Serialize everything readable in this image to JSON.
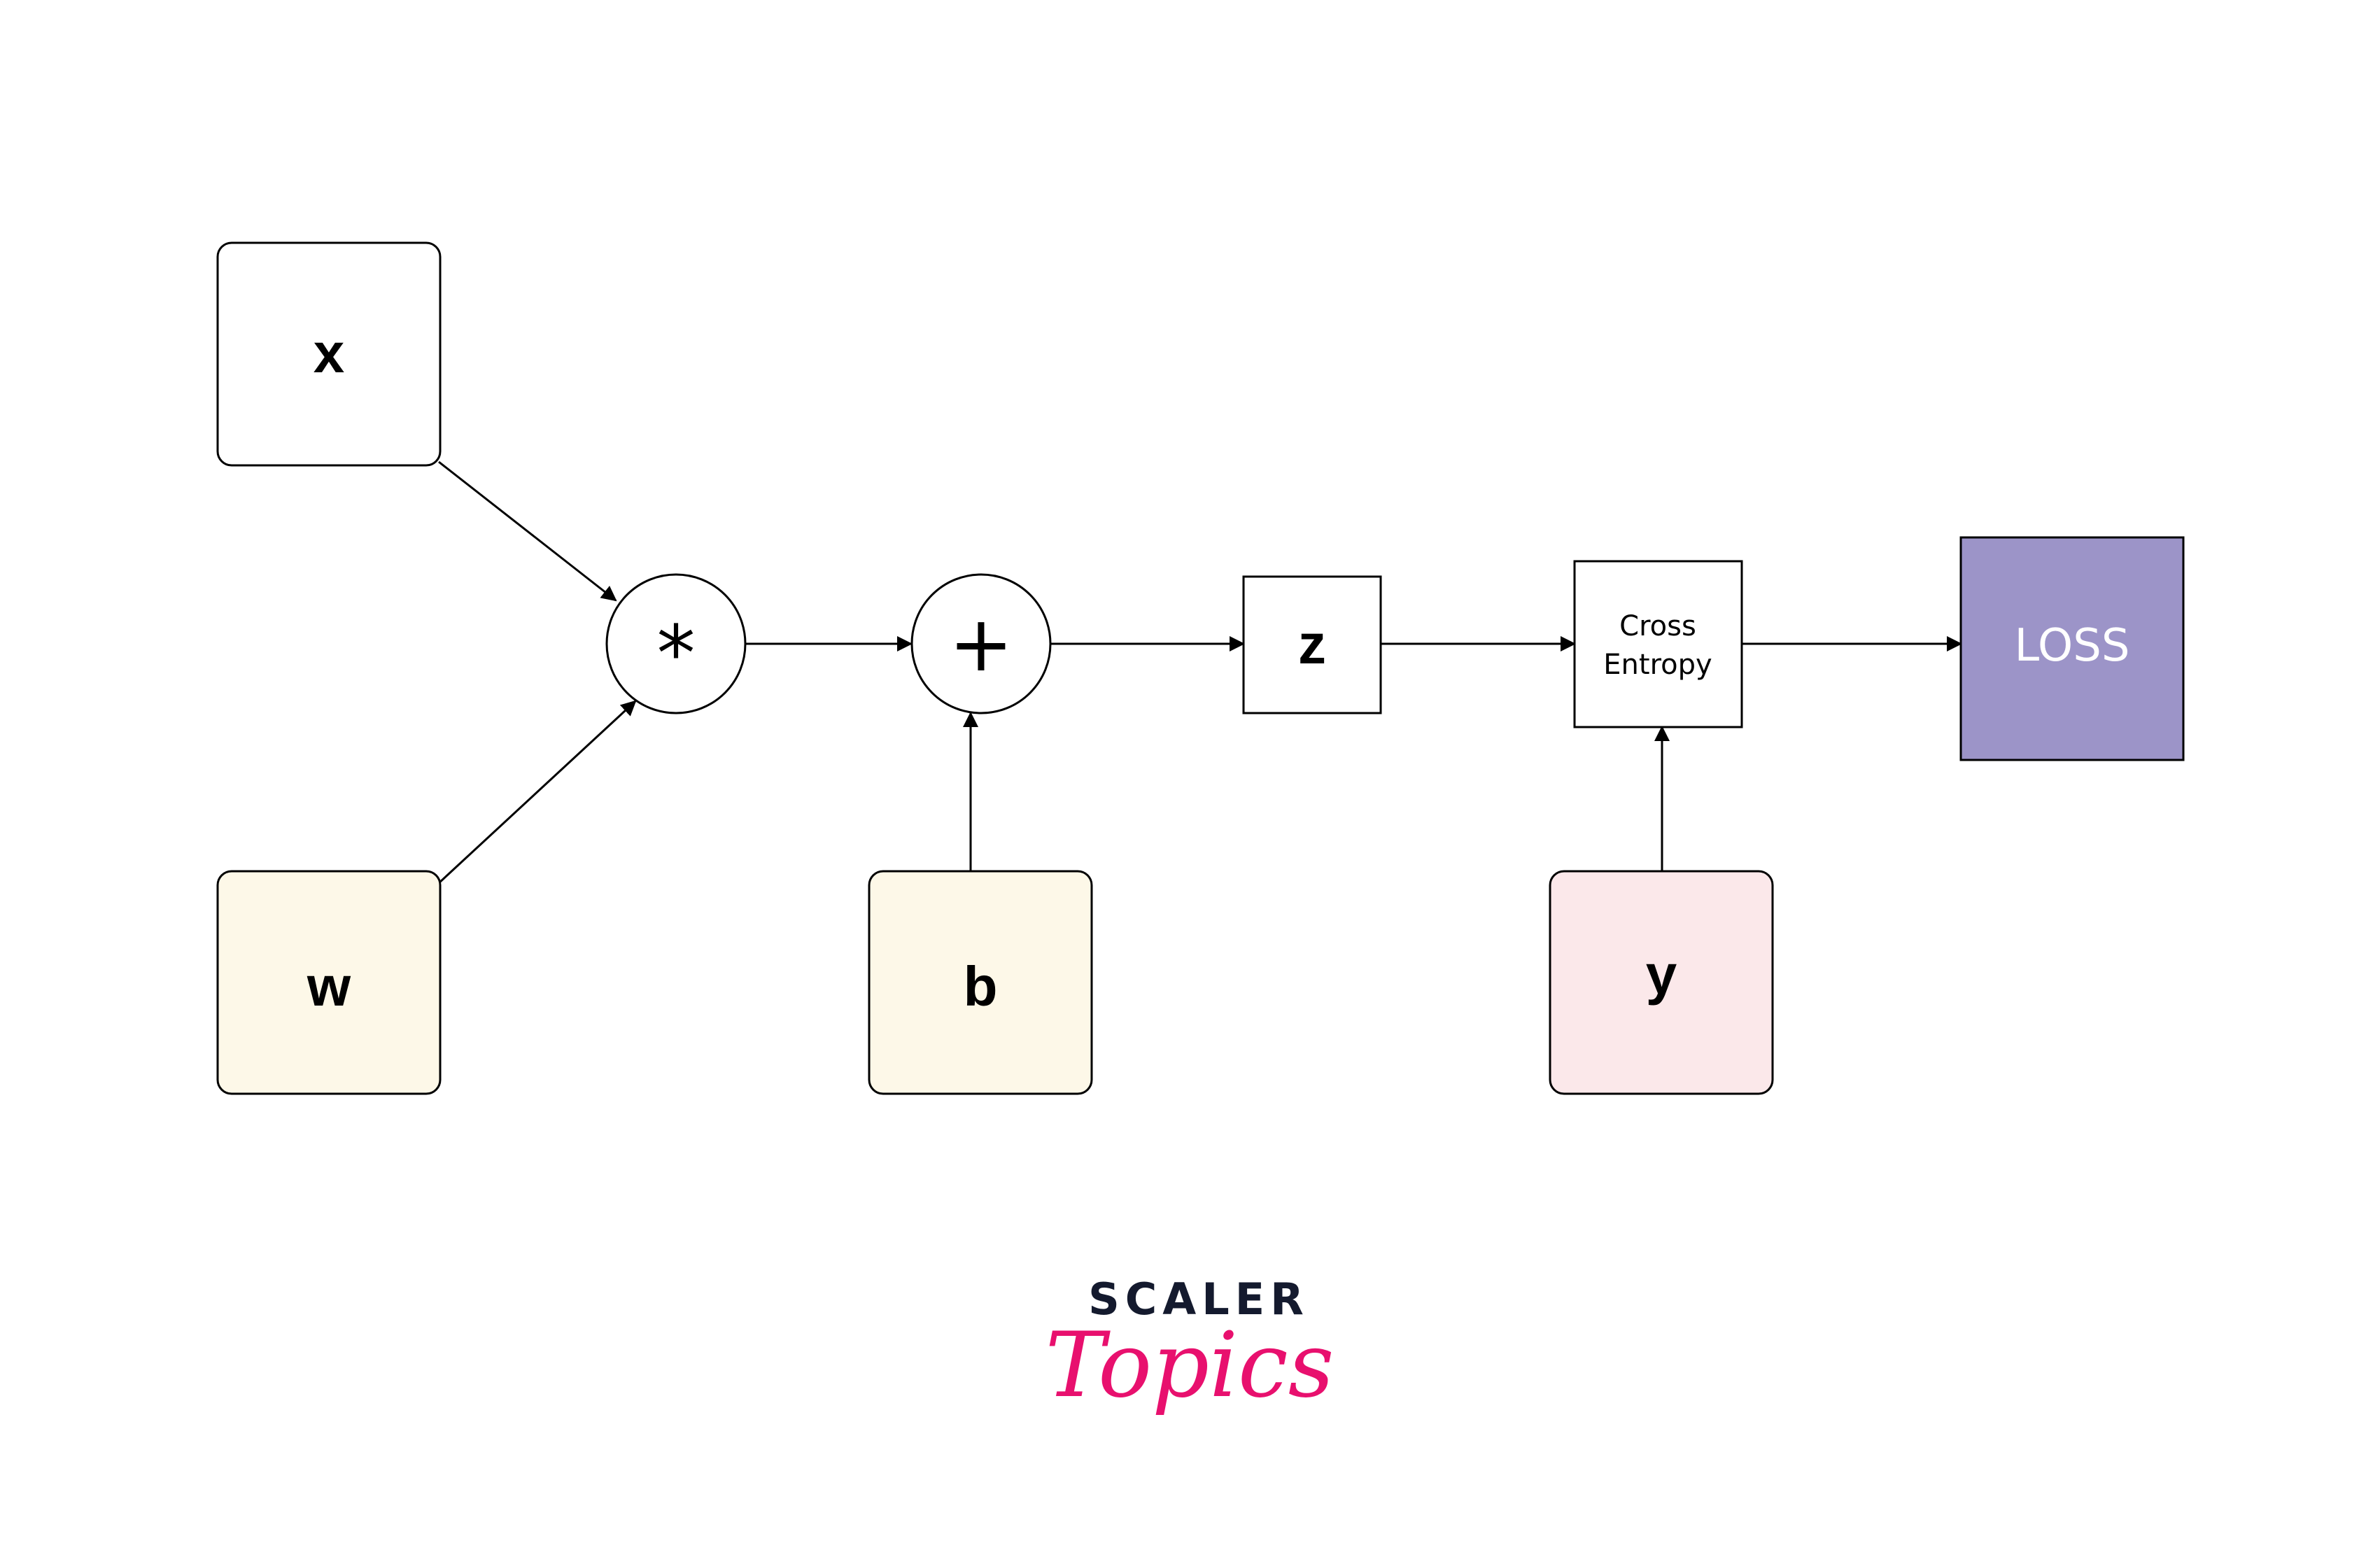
{
  "nodes": {
    "x": {
      "label": "x",
      "kind": "input",
      "fill": "#ffffff"
    },
    "w": {
      "label": "w",
      "kind": "parameter",
      "fill": "#fdf8e8"
    },
    "b": {
      "label": "b",
      "kind": "parameter",
      "fill": "#fdf8e8"
    },
    "y": {
      "label": "y",
      "kind": "target",
      "fill": "#fbe8ea"
    },
    "mul": {
      "label": "*",
      "kind": "operation"
    },
    "add": {
      "label": "+",
      "kind": "operation"
    },
    "z": {
      "label": "z",
      "kind": "intermediate",
      "fill": "#ffffff"
    },
    "cross_entropy": {
      "line1": "Cross",
      "line2": "Entropy",
      "kind": "function",
      "fill": "#ffffff"
    },
    "loss": {
      "label": "LOSS",
      "kind": "output",
      "fill": "#9c94c8"
    }
  },
  "edges": [
    {
      "from": "x",
      "to": "mul"
    },
    {
      "from": "w",
      "to": "mul"
    },
    {
      "from": "mul",
      "to": "add"
    },
    {
      "from": "b",
      "to": "add"
    },
    {
      "from": "add",
      "to": "z"
    },
    {
      "from": "z",
      "to": "cross_entropy"
    },
    {
      "from": "y",
      "to": "cross_entropy"
    },
    {
      "from": "cross_entropy",
      "to": "loss"
    }
  ],
  "logo": {
    "line1": "SCALER",
    "line2": "Topics",
    "colors": {
      "line1": "#141a2e",
      "line2": "#e8106e"
    }
  }
}
